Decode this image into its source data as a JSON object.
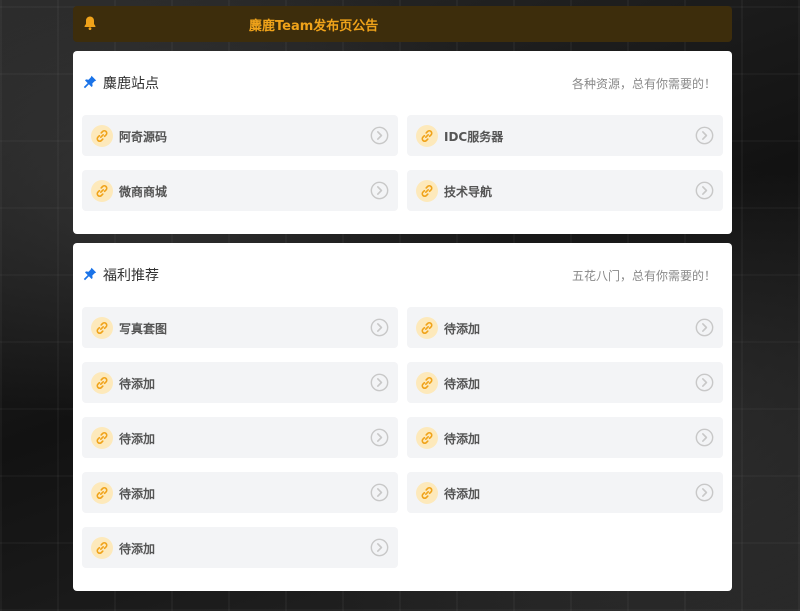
{
  "notice": {
    "text": "麋鹿Team发布页公告",
    "icon": "bell-icon",
    "color": "#f0a31a"
  },
  "sections": [
    {
      "title": "麋鹿站点",
      "subtitle": "各种资源，总有你需要的！",
      "icon": "pin-icon",
      "items": [
        {
          "label": "阿奇源码"
        },
        {
          "label": "IDC服务器"
        },
        {
          "label": "微商商城"
        },
        {
          "label": "技术导航"
        }
      ]
    },
    {
      "title": "福利推荐",
      "subtitle": "五花八门，总有你需要的！",
      "icon": "pin-icon",
      "items": [
        {
          "label": "写真套图"
        },
        {
          "label": "待添加"
        },
        {
          "label": "待添加"
        },
        {
          "label": "待添加"
        },
        {
          "label": "待添加"
        },
        {
          "label": "待添加"
        },
        {
          "label": "待添加"
        },
        {
          "label": "待添加"
        },
        {
          "label": "待添加"
        }
      ]
    }
  ],
  "theme": {
    "accent": "#f0a31a",
    "pin_color": "#1a73e8",
    "card_bg": "#ffffff",
    "item_bg": "#f3f4f6"
  }
}
